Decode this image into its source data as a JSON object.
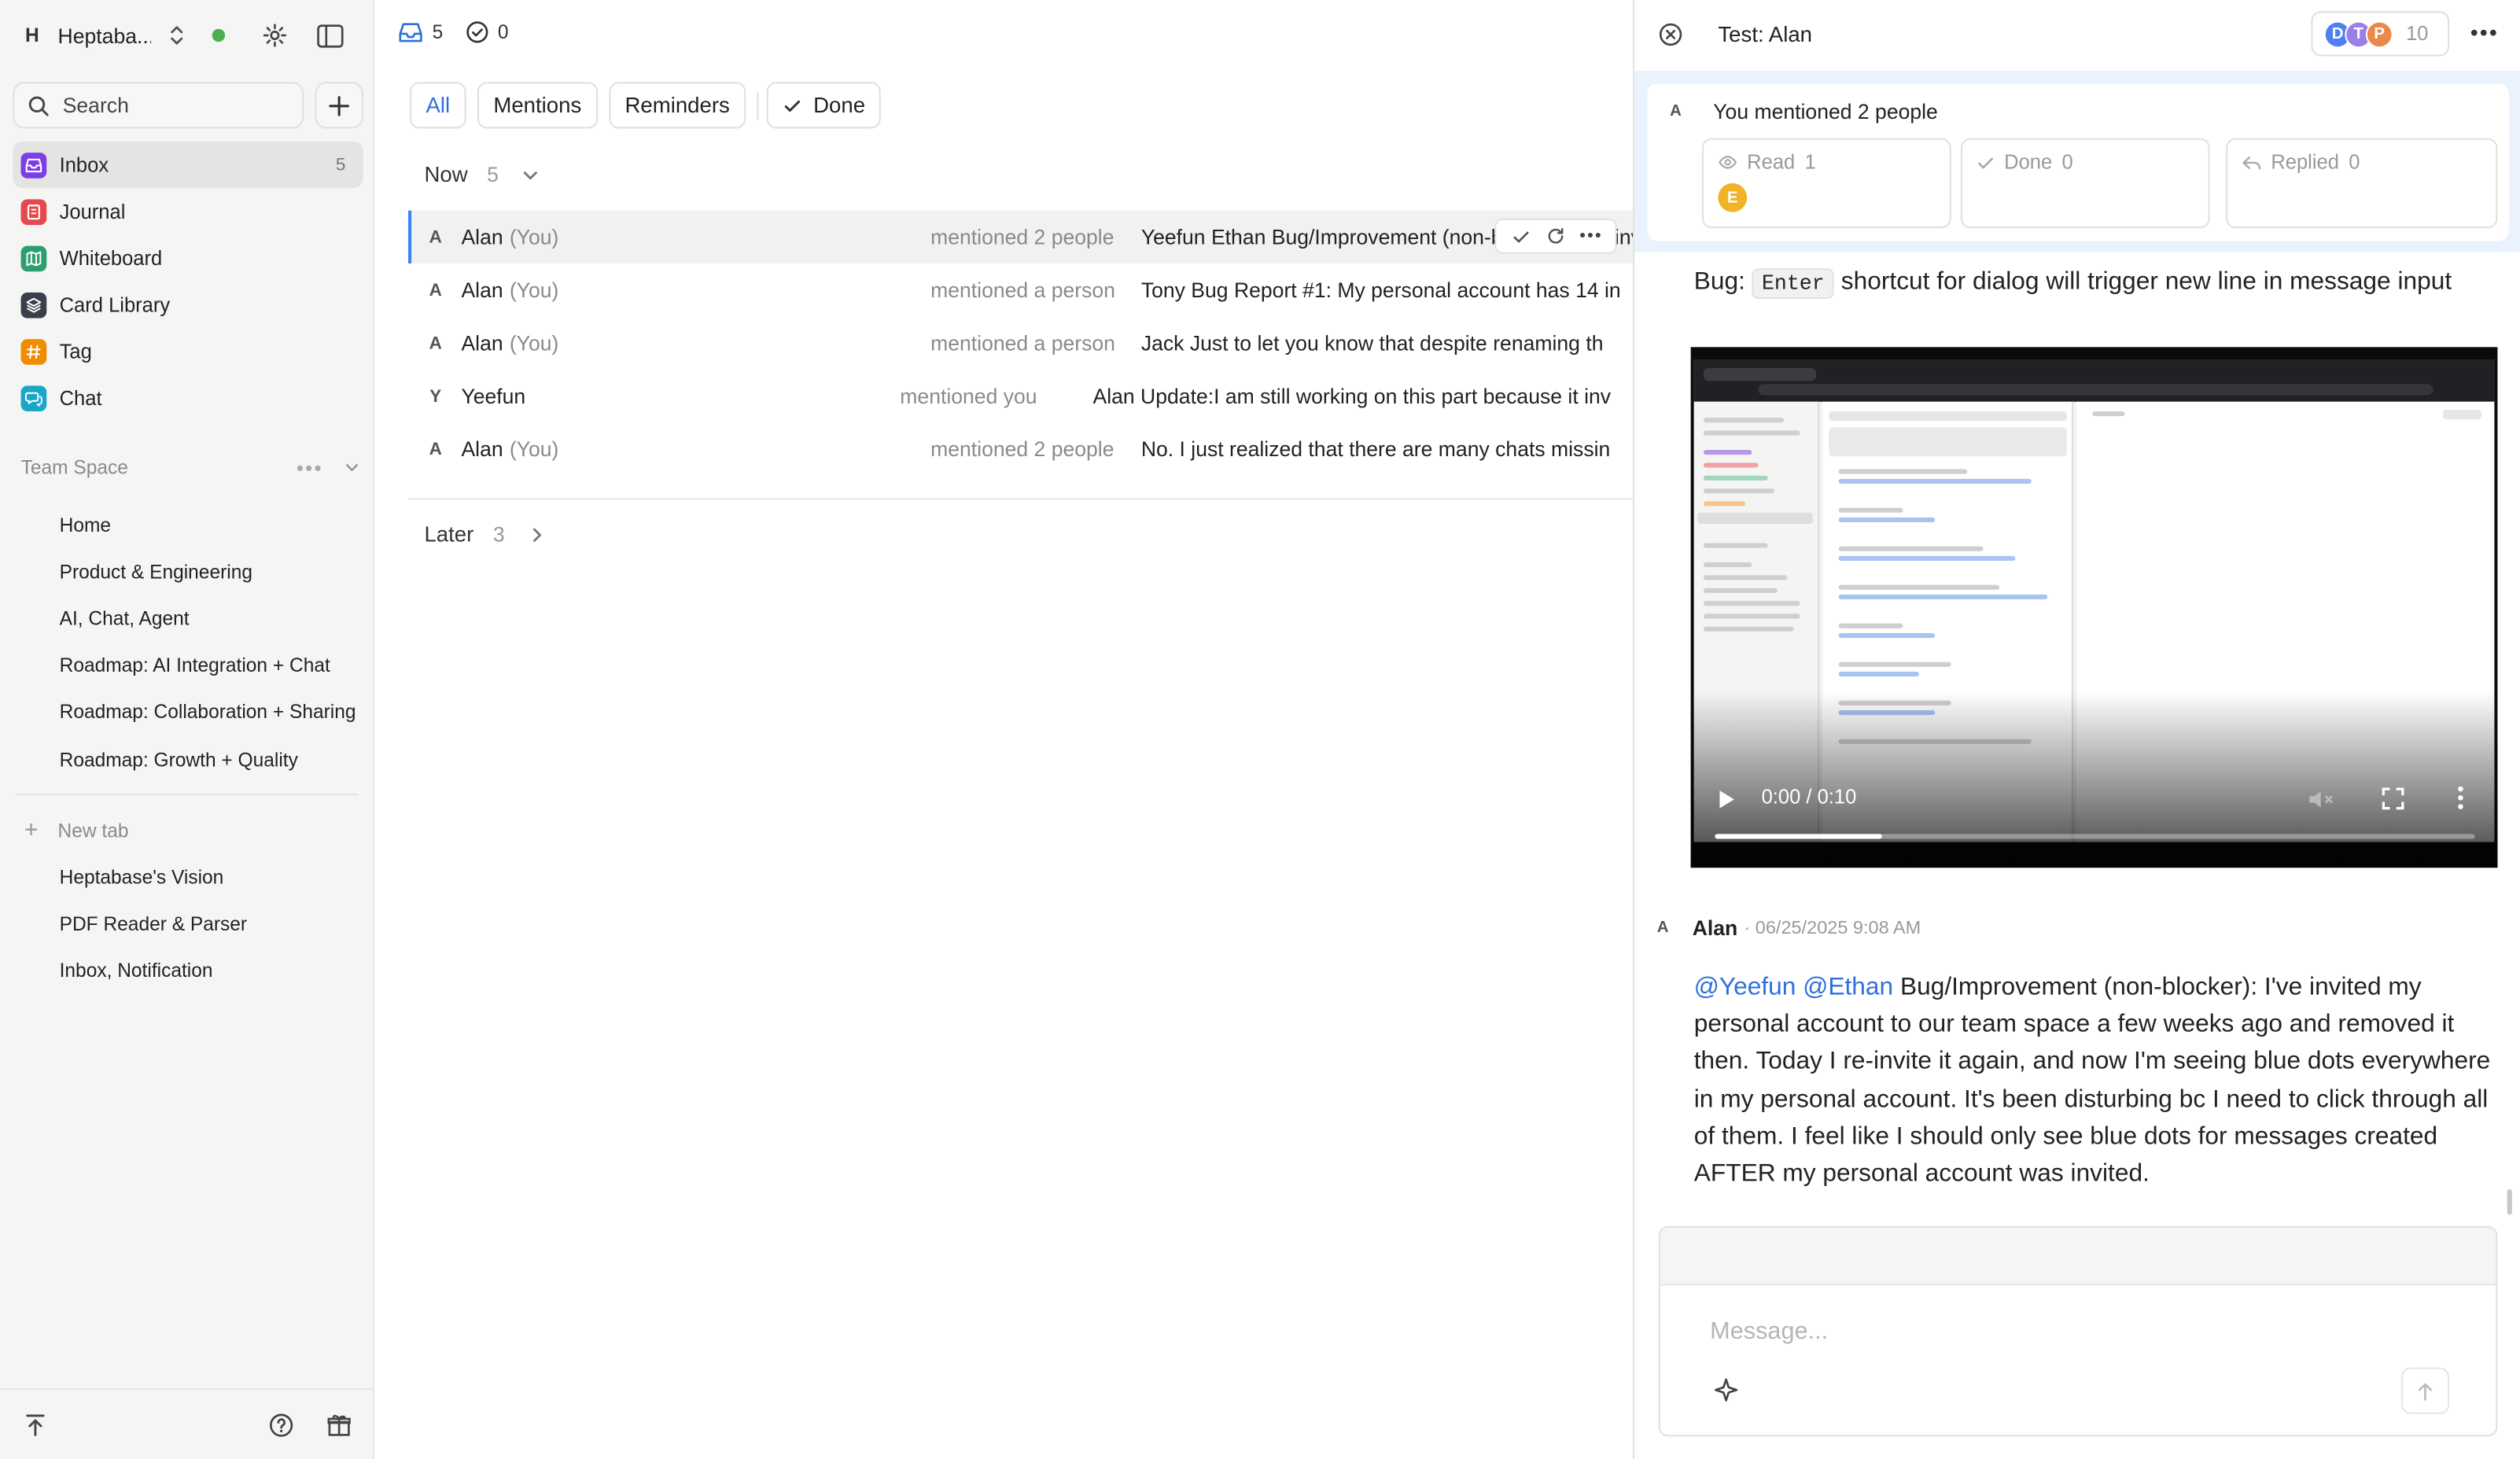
{
  "workspace": {
    "avatar_letter": "H",
    "name": "Heptaba..."
  },
  "search": {
    "placeholder": "Search"
  },
  "nav": [
    {
      "label": "Inbox",
      "count": "5",
      "color": "#7b3fe4",
      "icon": "inbox-icon"
    },
    {
      "label": "Journal",
      "count": "",
      "color": "#e5484d",
      "icon": "journal-icon"
    },
    {
      "label": "Whiteboard",
      "count": "",
      "color": "#2f9e6f",
      "icon": "whiteboard-icon"
    },
    {
      "label": "Card Library",
      "count": "",
      "color": "#3a3f4b",
      "icon": "card-library-icon"
    },
    {
      "label": "Tag",
      "count": "",
      "color": "#f08c00",
      "icon": "tag-icon"
    },
    {
      "label": "Chat",
      "count": "",
      "color": "#1ba6c8",
      "icon": "chat-icon"
    }
  ],
  "team_space": {
    "label": "Team Space",
    "items": [
      {
        "label": "Home",
        "icon": "whiteboard-icon"
      },
      {
        "label": "Product & Engineering",
        "icon": "whiteboard-icon"
      },
      {
        "label": "AI, Chat, Agent",
        "icon": "whiteboard-icon"
      },
      {
        "label": "Roadmap: AI Integration + Chat",
        "icon": "page-icon"
      },
      {
        "label": "Roadmap: Collaboration + Sharing",
        "icon": "page-icon"
      },
      {
        "label": "Roadmap: Growth + Quality",
        "icon": "page-icon"
      }
    ]
  },
  "tabs": {
    "new_tab_label": "New tab",
    "items": [
      {
        "label": "Heptabase's Vision",
        "icon": "page-icon"
      },
      {
        "label": "PDF Reader & Parser",
        "icon": "whiteboard-icon"
      },
      {
        "label": "Inbox, Notification",
        "icon": "whiteboard-icon"
      }
    ]
  },
  "inbox": {
    "unread_count": "5",
    "done_count": "0",
    "filters": [
      "All",
      "Mentions",
      "Reminders",
      "Done"
    ],
    "active_filter": "All",
    "now_group": {
      "label": "Now",
      "count": "5"
    },
    "later_group": {
      "label": "Later",
      "count": "3"
    },
    "rows": [
      {
        "avatar": "A",
        "name": "Alan",
        "you": "(You)",
        "action": "mentioned 2 people",
        "message": "Yeefun Ethan Bug/Improvement (non-blocker): I've invited my personal account to our team space a few weeks ago and removed it then.",
        "active": true
      },
      {
        "avatar": "A",
        "name": "Alan",
        "you": "(You)",
        "action": "mentioned a person",
        "message": "Tony Bug Report #1: My personal account has 14 in",
        "active": false
      },
      {
        "avatar": "A",
        "name": "Alan",
        "you": "(You)",
        "action": "mentioned a person",
        "message": "Jack Just to let you know that despite renaming th",
        "active": false
      },
      {
        "avatar": "Y",
        "name": "Yeefun",
        "you": "",
        "action": "mentioned you",
        "message": "Alan Update:I am still working on this part because it inv",
        "active": false
      },
      {
        "avatar": "A",
        "name": "Alan",
        "you": "(You)",
        "action": "mentioned 2 people",
        "message": "No. I just realized that there are many chats missin",
        "active": false
      }
    ]
  },
  "detail": {
    "title": "Test: Alan",
    "participants": [
      {
        "letter": "D",
        "color": "#4f7ff0"
      },
      {
        "letter": "T",
        "color": "#9b7fe6"
      },
      {
        "letter": "P",
        "color": "#e98a4a"
      }
    ],
    "participant_count": "10",
    "mention_summary": {
      "avatar": "A",
      "text": "You mentioned 2 people"
    },
    "stats": [
      {
        "label": "Read",
        "value": "1",
        "icon": "eye-icon",
        "reader": "E"
      },
      {
        "label": "Done",
        "value": "0",
        "icon": "check-icon",
        "reader": ""
      },
      {
        "label": "Replied",
        "value": "0",
        "icon": "reply-icon",
        "reader": ""
      }
    ],
    "bug_title_prefix": "Bug:",
    "bug_title_code": "Enter",
    "bug_title_suffix": "shortcut for dialog will trigger new line in message input",
    "video": {
      "time": "0:00 / 0:10",
      "progress": 0.22
    },
    "message": {
      "avatar": "A",
      "author": "Alan",
      "timestamp": "· 06/25/2025 9:08 AM",
      "mentions": [
        "@Yeefun",
        "@Ethan"
      ],
      "body": "Bug/Improvement (non-blocker): I've invited my personal account to our team space a few weeks ago and removed it then. Today I re-invite it again, and now I'm seeing blue dots everywhere in my personal account. It's been disturbing bc I need to click through all of them. I feel like I should only see blue dots for messages created AFTER my personal account was invited."
    },
    "composer": {
      "placeholder": "Message..."
    }
  },
  "colors": {
    "accent": "#2f6fdc",
    "mention_bg": "#eaf2fd",
    "online": "#4caf50"
  }
}
